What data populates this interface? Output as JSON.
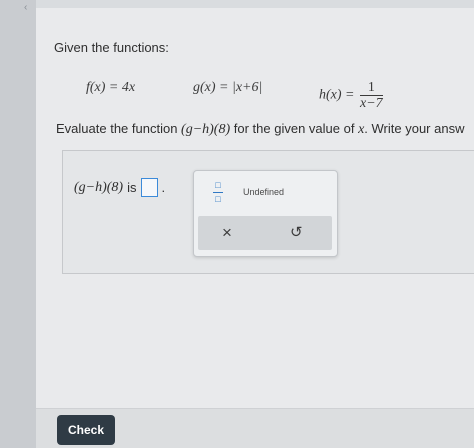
{
  "question": {
    "prompt": "Given the functions:",
    "functions": {
      "f": "f(x) = 4x",
      "g": "g(x) = |x+6|",
      "h_lhs": "h(x) =",
      "h_num": "1",
      "h_den": "x−7"
    },
    "instruction_prefix": "Evaluate the function ",
    "instruction_expr": "(g−h)(8)",
    "instruction_middle": " for the given value of ",
    "instruction_var": "x",
    "instruction_suffix": ". Write your answ"
  },
  "answer": {
    "expr": "(g−h)(8)",
    "is_label": "is",
    "trailing": "."
  },
  "palette": {
    "fraction_glyph_top": "□",
    "fraction_glyph_bottom": "□",
    "undefined_label": "Undefined",
    "clear_glyph": "×",
    "undo_glyph": "↺"
  },
  "footer": {
    "check_label": "Check"
  },
  "nav": {
    "back_glyph": "‹"
  }
}
